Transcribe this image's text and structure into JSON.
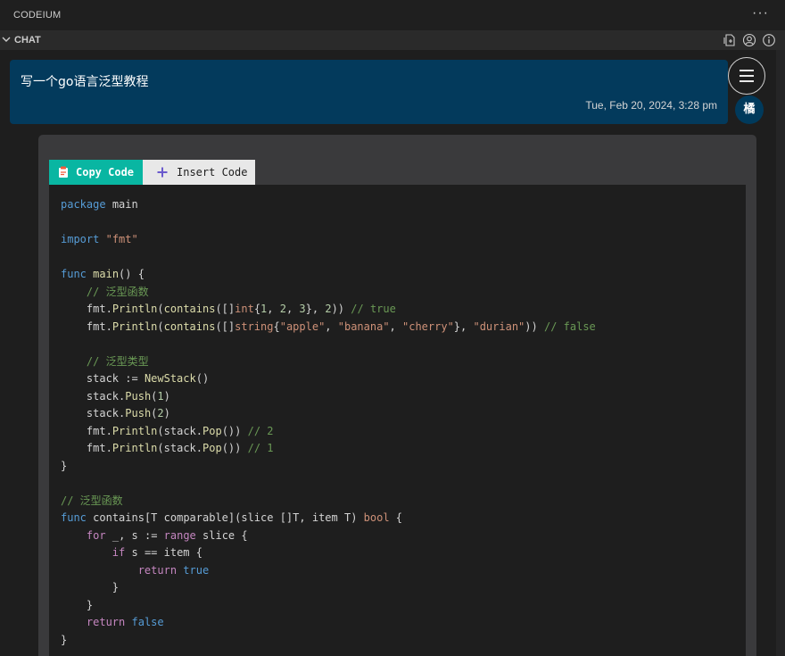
{
  "titlebar": {
    "title": "CODEIUM",
    "more": "···"
  },
  "section": {
    "label": "CHAT"
  },
  "user_message": {
    "text": "写一个go语言泛型教程",
    "timestamp": "Tue, Feb 20, 2024, 3:28 pm"
  },
  "avatar": {
    "initial": "橘"
  },
  "code_toolbar": {
    "copy_label": "Copy Code",
    "insert_label": "Insert Code"
  },
  "code": {
    "language": "go",
    "lines": [
      "package main",
      "",
      "import \"fmt\"",
      "",
      "func main() {",
      "    // 泛型函数",
      "    fmt.Println(contains([]int{1, 2, 3}, 2)) // true",
      "    fmt.Println(contains([]string{\"apple\", \"banana\", \"cherry\"}, \"durian\")) // false",
      "",
      "    // 泛型类型",
      "    stack := NewStack()",
      "    stack.Push(1)",
      "    stack.Push(2)",
      "    fmt.Println(stack.Pop()) // 2",
      "    fmt.Println(stack.Pop()) // 1",
      "}",
      "",
      "// 泛型函数",
      "func contains[T comparable](slice []T, item T) bool {",
      "    for _, s := range slice {",
      "        if s == item {",
      "            return true",
      "        }",
      "    }",
      "    return false",
      "}"
    ]
  },
  "colors": {
    "user_bubble": "#033a5c",
    "copy_button": "#09b6a2",
    "insert_button": "#e8e8e8",
    "code_bg": "#1e1e1e",
    "card_bg": "#3a3a3c"
  }
}
